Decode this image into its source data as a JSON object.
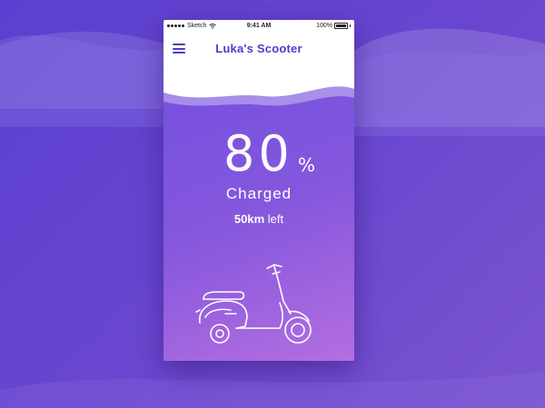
{
  "status_bar": {
    "carrier": "Sketch",
    "time": "9:41 AM",
    "battery": "100%"
  },
  "header": {
    "title": "Luka's Scooter",
    "menu_icon": "hamburger-menu-icon"
  },
  "charge": {
    "value": "80",
    "unit": "%",
    "status": "Charged",
    "range_value": "50km",
    "range_suffix": "left",
    "level_percent": 80
  },
  "illustration": {
    "icon": "scooter-icon"
  },
  "colors": {
    "accent": "#4b3cc8",
    "background": "#5b3fd0",
    "gradient_end": "#b46ee0",
    "text_light": "#ffffff"
  }
}
